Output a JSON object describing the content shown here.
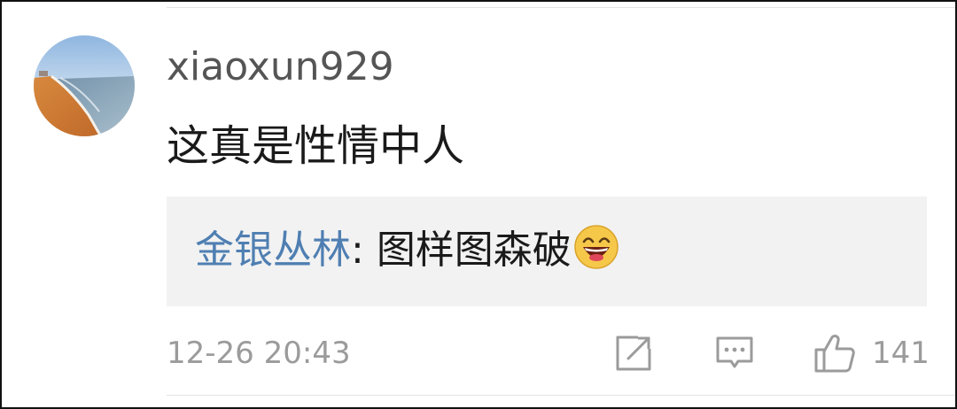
{
  "comment": {
    "username": "xiaoxun929",
    "text": "这真是性情中人",
    "timestamp": "12-26 20:43"
  },
  "reply": {
    "author": "金银丛林",
    "separator": ": ",
    "text": "图样图森破",
    "emoji": "laughing-face-icon"
  },
  "actions": {
    "share_icon": "edit-share-icon",
    "comment_icon": "comment-bubble-icon",
    "like_icon": "thumbs-up-icon",
    "like_count": "141"
  },
  "colors": {
    "username": "#555555",
    "reply_author": "#4f7fb2",
    "meta": "#9b9b9b",
    "reply_background": "#f2f2f2"
  }
}
